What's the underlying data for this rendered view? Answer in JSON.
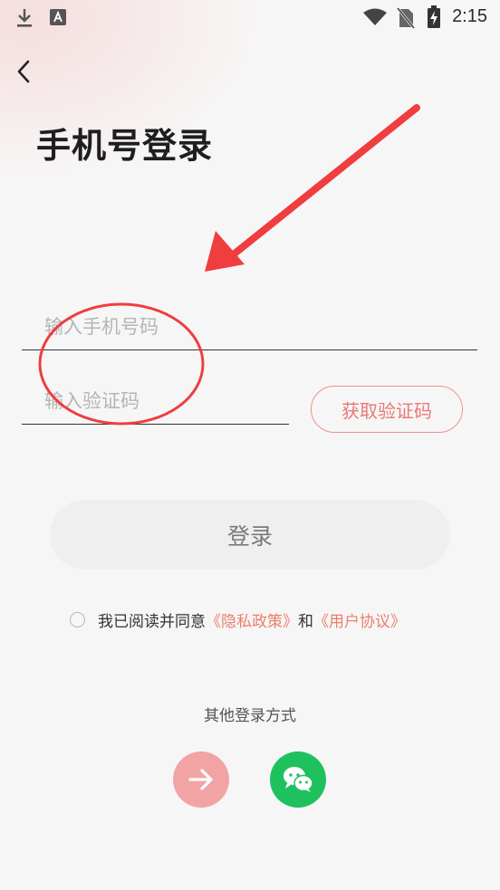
{
  "status_bar": {
    "time": "2:15",
    "icons": [
      "download-icon",
      "font-a-icon",
      "wifi-icon",
      "no-sim-icon",
      "battery-charging-icon"
    ]
  },
  "header": {
    "back_icon": "chevron-left-icon",
    "title": "手机号登录"
  },
  "form": {
    "phone_placeholder": "输入手机号码",
    "code_placeholder": "输入验证码",
    "get_code_label": "获取验证码",
    "login_label": "登录"
  },
  "agreement": {
    "prefix": "我已阅读并同意",
    "privacy_link": "《隐私政策》",
    "conjunction": "和",
    "user_link": "《用户协议》"
  },
  "other_login": {
    "label": "其他登录方式",
    "options": [
      {
        "icon": "arrow-right-icon",
        "color": "#f2a3a3"
      },
      {
        "icon": "wechat-icon",
        "color": "#1fc15f"
      }
    ]
  },
  "colors": {
    "accent": "#e97878",
    "annotation": "#ef3e40",
    "wechat": "#1fc15f"
  }
}
